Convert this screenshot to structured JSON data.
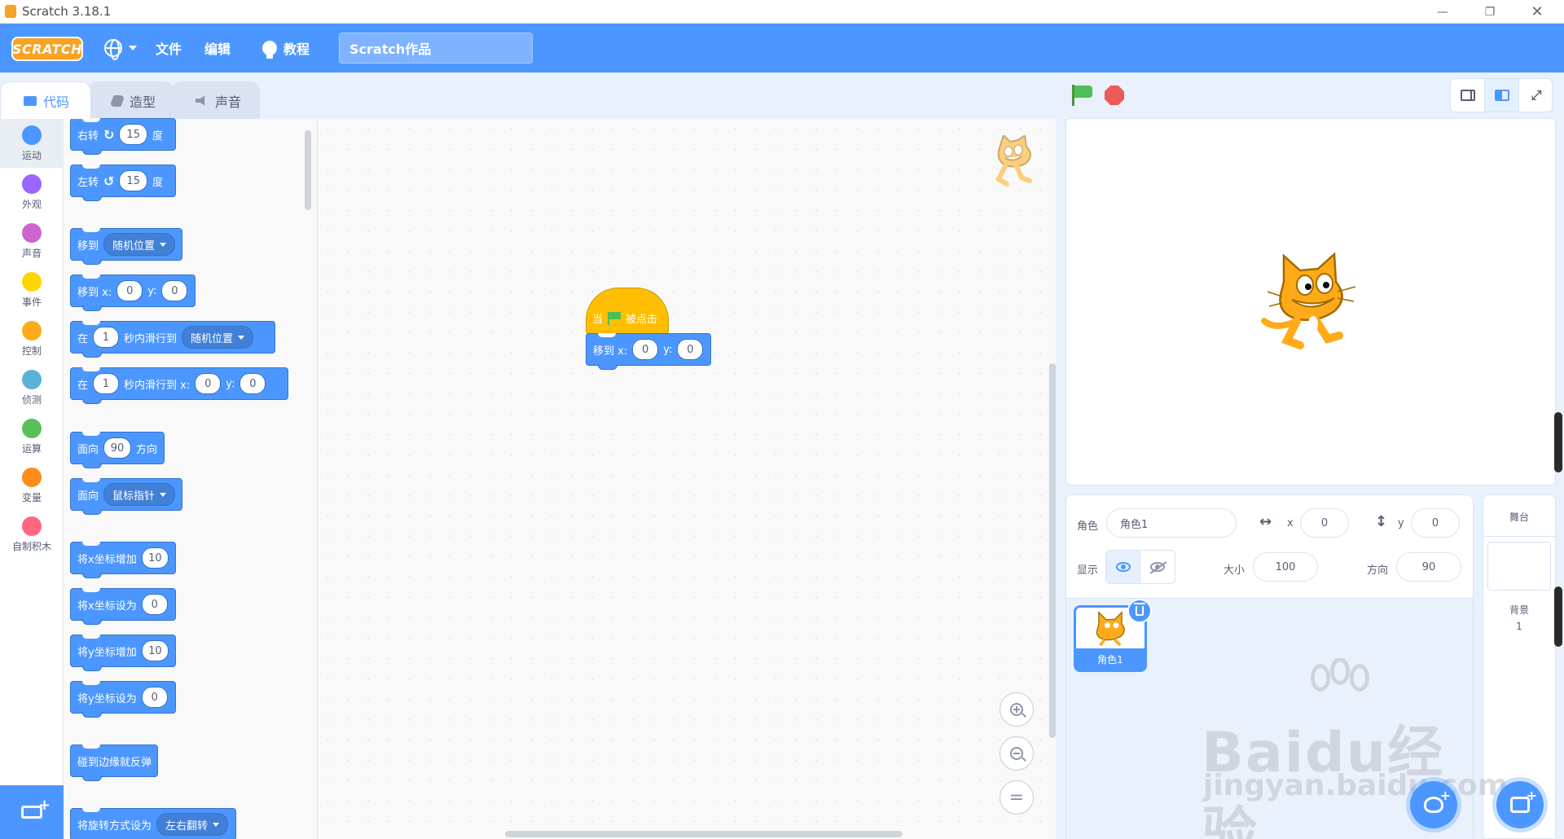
{
  "window": {
    "title": "Scratch 3.18.1",
    "min": "—",
    "max": "❐",
    "close": "✕"
  },
  "menubar": {
    "logo": "SCRATCH",
    "file": "文件",
    "edit": "编辑",
    "tutorials": "教程",
    "project_title": "Scratch作品"
  },
  "tabs": [
    {
      "label": "代码"
    },
    {
      "label": "造型"
    },
    {
      "label": "声音"
    }
  ],
  "categories": [
    {
      "label": "运动",
      "color": "#4c97ff"
    },
    {
      "label": "外观",
      "color": "#9966ff"
    },
    {
      "label": "声音",
      "color": "#cf63cf"
    },
    {
      "label": "事件",
      "color": "#ffd500"
    },
    {
      "label": "控制",
      "color": "#ffab19"
    },
    {
      "label": "侦测",
      "color": "#5cb1d6"
    },
    {
      "label": "运算",
      "color": "#59c059"
    },
    {
      "label": "变量",
      "color": "#ff8c1a"
    },
    {
      "label": "自制积木",
      "color": "#ff6680"
    }
  ],
  "blocks": {
    "turn_right": {
      "text": "右转",
      "value": "15",
      "unit": "度"
    },
    "turn_left": {
      "text": "左转",
      "value": "15",
      "unit": "度"
    },
    "goto": {
      "text": "移到",
      "option": "随机位置"
    },
    "goto_xy": {
      "text": "移到 x:",
      "x": "0",
      "ylabel": "y:",
      "y": "0"
    },
    "glide_to": {
      "prefix": "在",
      "secs": "1",
      "mid": "秒内滑行到",
      "option": "随机位置"
    },
    "glide_xy": {
      "prefix": "在",
      "secs": "1",
      "mid": "秒内滑行到 x:",
      "x": "0",
      "ylabel": "y:",
      "y": "0"
    },
    "point_dir": {
      "text": "面向",
      "value": "90",
      "unit": "方向"
    },
    "point_towards": {
      "text": "面向",
      "option": "鼠标指针"
    },
    "change_x": {
      "text": "将x坐标增加",
      "value": "10"
    },
    "set_x": {
      "text": "将x坐标设为",
      "value": "0"
    },
    "change_y": {
      "text": "将y坐标增加",
      "value": "10"
    },
    "set_y": {
      "text": "将y坐标设为",
      "value": "0"
    },
    "bounce": {
      "text": "碰到边缘就反弹"
    },
    "rotation_style": {
      "text": "将旋转方式设为",
      "option": "左右翻转"
    }
  },
  "script": {
    "hat_when": "当",
    "hat_clicked": "被点击",
    "goto_label": "移到 x:",
    "x": "0",
    "ylabel": "y:",
    "y": "0"
  },
  "sprite_info": {
    "sprite_label": "角色",
    "sprite_name": "角色1",
    "x_label": "x",
    "x": "0",
    "y_label": "y",
    "y": "0",
    "show_label": "显示",
    "size_label": "大小",
    "size": "100",
    "direction_label": "方向",
    "direction": "90"
  },
  "sprites": [
    {
      "name": "角色1"
    }
  ],
  "stage_panel": {
    "title": "舞台",
    "backdrops_label": "背景",
    "backdrops_count": "1"
  },
  "watermark": {
    "line1": "Baidu经验",
    "line2": "jingyan.baidu.com"
  },
  "colors": {
    "accent": "#4c97ff",
    "events": "#ffbf00",
    "menubar": "#4c97ff"
  }
}
